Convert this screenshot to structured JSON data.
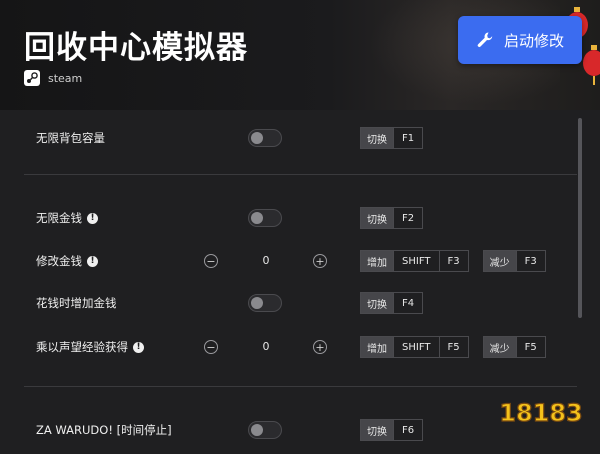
{
  "header": {
    "title": "回收中心模拟器",
    "platform": "steam",
    "launch_label": "启动修改"
  },
  "rows": [
    {
      "label": "无限背包容量",
      "info": false,
      "control": "toggle",
      "keys": [
        {
          "action": "切换",
          "caps": [
            "F1"
          ]
        }
      ]
    },
    {
      "label": "无限金钱",
      "info": true,
      "control": "toggle",
      "keys": [
        {
          "action": "切换",
          "caps": [
            "F2"
          ]
        }
      ]
    },
    {
      "label": "修改金钱",
      "info": true,
      "control": "stepper",
      "value": "0",
      "minus": "−",
      "plus": "+",
      "keys": [
        {
          "action": "增加",
          "caps": [
            "SHIFT",
            "F3"
          ]
        },
        {
          "action": "减少",
          "caps": [
            "F3"
          ]
        }
      ]
    },
    {
      "label": "花钱时增加金钱",
      "info": false,
      "control": "toggle",
      "keys": [
        {
          "action": "切换",
          "caps": [
            "F4"
          ]
        }
      ]
    },
    {
      "label": "乘以声望经验获得",
      "info": true,
      "control": "stepper",
      "value": "0",
      "minus": "−",
      "plus": "+",
      "keys": [
        {
          "action": "增加",
          "caps": [
            "SHIFT",
            "F5"
          ]
        },
        {
          "action": "减少",
          "caps": [
            "F5"
          ]
        }
      ]
    },
    {
      "label": "ZA WARUDO! [时间停止]",
      "info": false,
      "control": "toggle",
      "keys": [
        {
          "action": "切换",
          "caps": [
            "F6"
          ]
        }
      ]
    }
  ],
  "info_glyph": "!",
  "watermark": "18183",
  "colors": {
    "accent": "#3b6cf0",
    "background": "#1f1f21",
    "lantern": "#d8282a"
  },
  "icons": {
    "platform": "steam-icon",
    "launch": "wrench-icon",
    "info": "info-icon"
  }
}
